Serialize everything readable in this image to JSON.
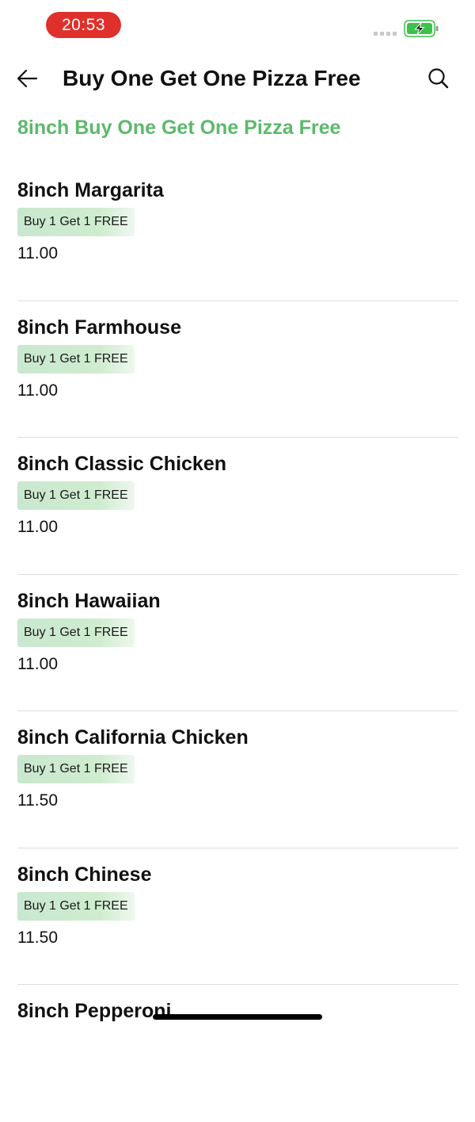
{
  "status_bar": {
    "time": "20:53",
    "icons": [
      "signal-dots-icon",
      "battery-charging-icon"
    ],
    "colors": {
      "time_pill": "#e0302b",
      "battery": "#3cc24a"
    }
  },
  "header": {
    "title": "Buy One Get One Pizza Free",
    "back_icon": "arrow-left-icon",
    "search_icon": "search-icon"
  },
  "section": {
    "title": "8inch Buy One Get One Pizza Free",
    "accent_color": "#5cb96a"
  },
  "items": [
    {
      "name": "8inch Margarita",
      "badge": "Buy 1 Get 1 FREE",
      "price": "11.00"
    },
    {
      "name": "8inch Farmhouse",
      "badge": "Buy 1 Get 1 FREE",
      "price": "11.00"
    },
    {
      "name": "8inch Classic Chicken",
      "badge": "Buy 1 Get 1 FREE",
      "price": "11.00"
    },
    {
      "name": "8inch Hawaiian",
      "badge": "Buy 1 Get 1 FREE",
      "price": "11.00"
    },
    {
      "name": "8inch California Chicken",
      "badge": "Buy 1 Get 1 FREE",
      "price": "11.50"
    },
    {
      "name": "8inch Chinese",
      "badge": "Buy 1 Get 1 FREE",
      "price": "11.50"
    },
    {
      "name": "8inch Pepperoni",
      "badge": "",
      "price": ""
    }
  ]
}
